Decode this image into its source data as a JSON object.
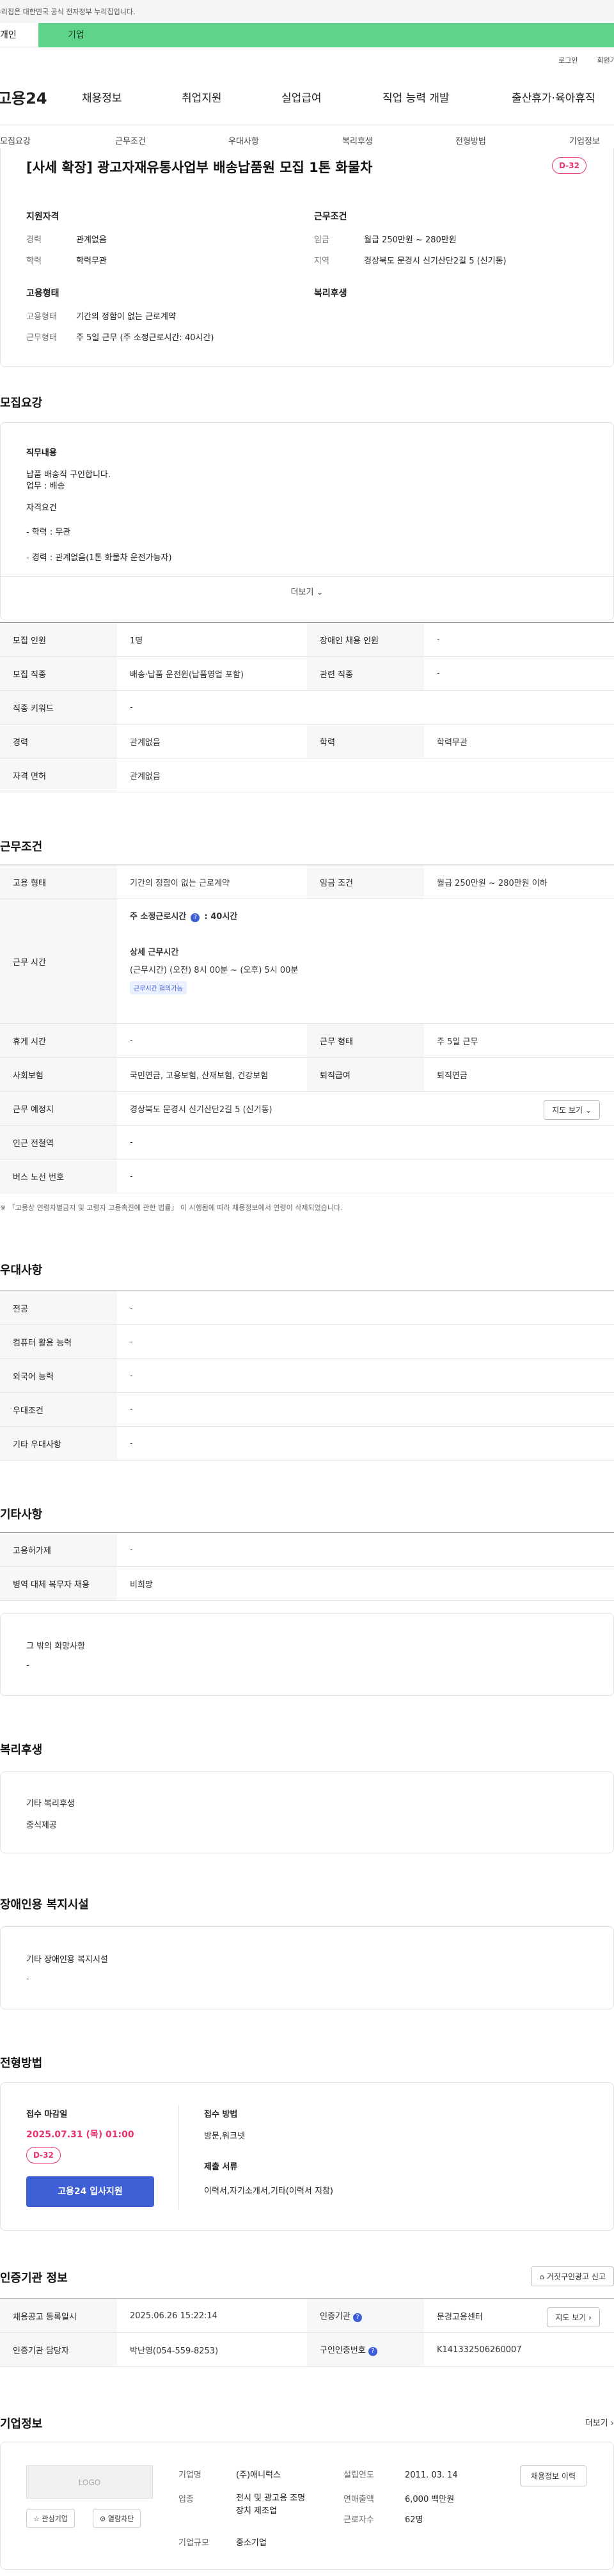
{
  "gov_banner": "이 누리집은 대한민국 공식 전자정부 누리집입니다.",
  "tabs": {
    "personal": "개인",
    "company": "기업"
  },
  "util": {
    "login": "로그인",
    "join": "회원가입"
  },
  "gnb": {
    "logo": "고용24",
    "items": [
      "채용정보",
      "취업지원",
      "실업급여",
      "직업 능력 개발",
      "출산휴가·육아휴직"
    ]
  },
  "subnav": [
    "모집요강",
    "근무조건",
    "우대사항",
    "복리후생",
    "전형방법",
    "기업정보"
  ],
  "job": {
    "title": "[사세 확장] 광고자재유통사업부 배송납품원 모집 1톤 화물차",
    "dday": "D-32",
    "summary": {
      "qual_title": "지원자격",
      "qual_rows": [
        {
          "k": "경력",
          "v": "관계없음"
        },
        {
          "k": "학력",
          "v": "학력무관"
        }
      ],
      "cond_title": "근무조건",
      "cond_rows": [
        {
          "k": "임금",
          "v": "월급 250만원 ~ 280만원"
        },
        {
          "k": "지역",
          "v": "경상북도 문경시 신기산단2길 5 (신기동)"
        }
      ],
      "emp_title": "고용형태",
      "emp_rows": [
        {
          "k": "고용형태",
          "v": "기간의 정함이 없는 근로계약"
        },
        {
          "k": "근무형태",
          "v": "주 5일 근무 (주 소정근로시간: 40시간)"
        }
      ],
      "welfare_title": "복리후생"
    }
  },
  "recruit": {
    "title": "모집요강",
    "duty_title": "직무내용",
    "duty_lines": [
      "납품 배송직 구인합니다.",
      "업무 : 배송"
    ],
    "req_title": "자격요건",
    "req_lines": [
      "- 학력 : 무관",
      "- 경력 : 관계없음(1톤 화물차 운전가능자)"
    ],
    "more": "더보기",
    "table": [
      [
        "모집 인원",
        "1명",
        "장애인 채용 인원",
        "-"
      ],
      [
        "모집 직종",
        "배송·납품 운전원(납품영업 포함)",
        "관련 직종",
        "-"
      ],
      [
        "직종 키워드",
        "-"
      ],
      [
        "경력",
        "관계없음",
        "학력",
        "학력무관"
      ],
      [
        "자격 면허",
        "관계없음"
      ]
    ]
  },
  "work": {
    "title": "근무조건",
    "type_k": "고용 형태",
    "type_v": "기간의 정함이 없는 근로계약",
    "wage_k": "임금 조건",
    "wage_v": "월급 250만원 ~ 280만원 이하",
    "hours_k": "근무 시간",
    "hours_main": "주 소정근로시간",
    "hours_value": ": 40시간",
    "hours_detail_title": "상세 근무시간",
    "hours_detail": "(근무시간) (오전) 8시 00분 ~ (오후) 5시 00분",
    "hours_badge": "근무시간 협의가능",
    "rows": [
      [
        "휴게 시간",
        "-",
        "근무 형태",
        "주 5일 근무"
      ],
      [
        "사회보험",
        "국민연금, 고용보험, 산재보험, 건강보험",
        "퇴직급여",
        "퇴직연금"
      ]
    ],
    "loc_k": "근무 예정지",
    "loc_v": "경상북도 문경시 신기산단2길 5 (신기동)",
    "map_btn": "지도 보기",
    "subway_k": "인근 전철역",
    "subway_v": "-",
    "bus_k": "버스 노선 번호",
    "bus_v": "-",
    "note": "※ 「고용상 연령차별금지 및 고령자 고용촉진에 관한 법률」 이 시행됨에 따라 채용정보에서 연령이 삭제되었습니다."
  },
  "pref": {
    "title": "우대사항",
    "rows": [
      [
        "전공",
        "-"
      ],
      [
        "컴퓨터 활용 능력",
        "-"
      ],
      [
        "외국어 능력",
        "-"
      ],
      [
        "우대조건",
        "-"
      ],
      [
        "기타 우대사항",
        "-"
      ]
    ]
  },
  "etc": {
    "title": "기타사항",
    "rows": [
      [
        "고용허가제",
        "-"
      ],
      [
        "병역 대체 복무자 채용",
        "비희망"
      ]
    ],
    "card_title": "그 밖의 희망사항",
    "card_value": "-"
  },
  "welfare": {
    "title": "복리후생",
    "card_title": "기타 복리후생",
    "card_value": "중식제공"
  },
  "disab": {
    "title": "장애인용 복지시설",
    "card_title": "기타 장애인용 복지시설",
    "card_value": "-"
  },
  "process": {
    "title": "전형방법",
    "deadline_title": "접수 마감일",
    "deadline": "2025.07.31 (목) 01:00",
    "dday": "D-32",
    "apply": "고용24 입사지원",
    "method_title": "접수 방법",
    "method": "방문,워크넷",
    "docs_title": "제출 서류",
    "docs": "이력서,자기소개서,기타(이력서 지참)"
  },
  "cert": {
    "title": "인증기관 정보",
    "report_btn": "거짓구인광고 신고",
    "r1": [
      "채용공고 등록일시",
      "2025.06.26 15:22:14",
      "인증기관",
      "문경고용센터"
    ],
    "map_btn": "지도 보기",
    "r2": [
      "인증기관 담당자",
      "박난영(054-559-8253)",
      "구인인증번호",
      "K141332506260007"
    ]
  },
  "company": {
    "title": "기업정보",
    "more": "더보기",
    "logo": "LOGO",
    "fav": "관심기업",
    "block": "열람차단",
    "name_k": "기업명",
    "name_v": "(주)애니럭스",
    "biz_k": "업종",
    "biz_v": "전시 및 광고용 조명장치 제조업",
    "size_k": "기업규모",
    "size_v": "중소기업",
    "found_k": "설립연도",
    "found_v": "2011. 03. 14",
    "rev_k": "연매출액",
    "rev_v": "6,000 백만원",
    "emp_k": "근로자수",
    "emp_v": "62명",
    "history_btn": "채용정보 이력"
  }
}
